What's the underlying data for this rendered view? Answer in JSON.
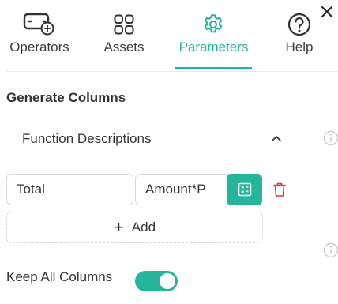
{
  "colors": {
    "accent": "#20b49a",
    "delete": "#e53935",
    "muted": "#c8c8c8"
  },
  "tabs": [
    {
      "label": "Operators",
      "icon": "operators-icon",
      "active": false
    },
    {
      "label": "Assets",
      "icon": "grid-icon",
      "active": false
    },
    {
      "label": "Parameters",
      "icon": "gear-icon",
      "active": true
    },
    {
      "label": "Help",
      "icon": "help-icon",
      "active": false
    }
  ],
  "section": {
    "title": "Generate Columns"
  },
  "function_descriptions": {
    "label": "Function Descriptions",
    "expanded": true
  },
  "columns": [
    {
      "name": "Total",
      "expression": "Amount*P"
    }
  ],
  "add_button": {
    "label": "Add"
  },
  "keep_all_columns": {
    "label": "Keep All Columns",
    "on": true
  }
}
